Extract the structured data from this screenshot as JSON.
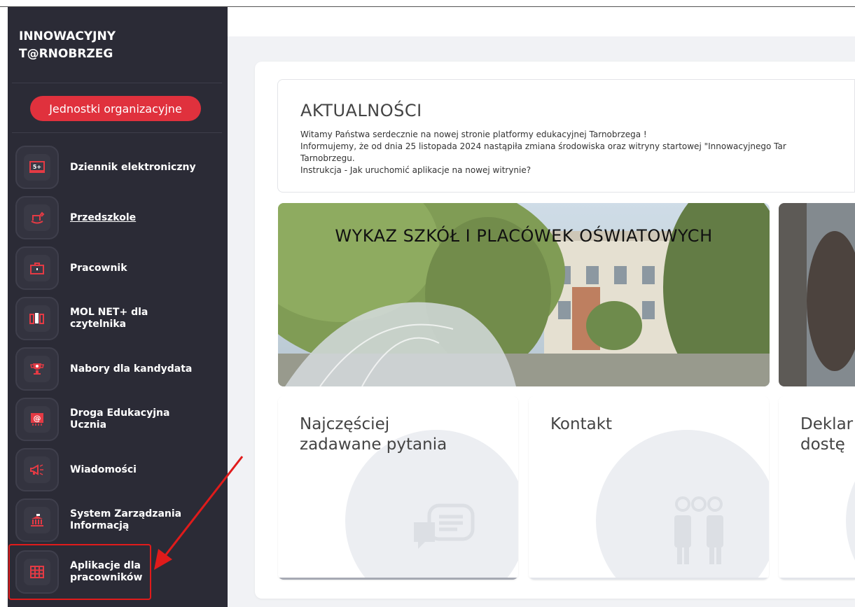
{
  "sidebar": {
    "brand_line1": "INNOWACYJNY",
    "brand_line2": "T@RNOBRZEG",
    "org_button": "Jednostki organizacyjne",
    "items": [
      {
        "label_line1": "Dziennik elektroniczny",
        "label_line2": "",
        "icon": "gradebook-icon"
      },
      {
        "label_line1": "Przedszkole",
        "label_line2": "",
        "icon": "rocking-horse-icon"
      },
      {
        "label_line1": "Pracownik",
        "label_line2": "",
        "icon": "briefcase-icon"
      },
      {
        "label_line1": "MOL NET+ dla",
        "label_line2": "czytelnika",
        "icon": "books-icon"
      },
      {
        "label_line1": "Nabory dla kandydata",
        "label_line2": "",
        "icon": "trophy-icon"
      },
      {
        "label_line1": "Droga Edukacyjna",
        "label_line2": "Ucznia",
        "icon": "at-board-icon"
      },
      {
        "label_line1": "Wiadomości",
        "label_line2": "",
        "icon": "megaphone-icon"
      },
      {
        "label_line1": "System Zarządzania",
        "label_line2": "Informacją",
        "icon": "building-icon"
      },
      {
        "label_line1": "Aplikacje dla",
        "label_line2": "pracowników",
        "icon": "grid-icon"
      }
    ]
  },
  "news": {
    "title": "AKTUALNOŚCI",
    "lines": [
      "Witamy Państwa serdecznie na nowej stronie platformy edukacyjnej Tarnobrzega !",
      "Informujemy, że od dnia 25 listopada 2024 nastąpiła zmiana środowiska oraz witryny startowej \"Innowacyjnego Tar",
      "Tarnobrzegu.",
      "Instrukcja - Jak uruchomić aplikacje na nowej witrynie?"
    ]
  },
  "banner": {
    "title": "WYKAZ SZKÓŁ I PLACÓWEK OŚWIATOWYCH"
  },
  "tiles": [
    {
      "line1": "Najczęściej",
      "line2": "zadawane pytania",
      "icon": "chat-bubble-icon"
    },
    {
      "line1": "Kontakt",
      "line2": "",
      "icon": "people-icon"
    },
    {
      "line1": "Deklar",
      "line2": "dostę",
      "icon": ""
    }
  ],
  "colors": {
    "sidebar_bg": "#2b2b36",
    "accent_red": "#e0313d",
    "icon_red": "#e43a44"
  }
}
